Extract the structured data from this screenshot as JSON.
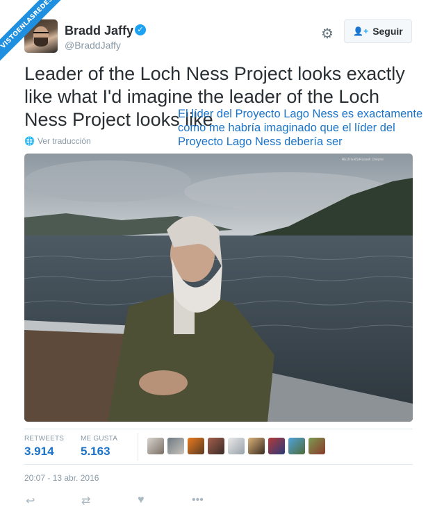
{
  "watermark": "VISTOENLASREDES",
  "author": {
    "name": "Bradd Jaffy",
    "handle": "@BraddJaffy",
    "verified": true
  },
  "header": {
    "settings_icon": "gear-icon",
    "follow_label": "Seguir"
  },
  "tweet": {
    "text": "Leader of the Loch Ness Project looks exactly like what I'd imagine the leader of the Loch Ness Project looks like",
    "translation_overlay": "El líder del Proyecto Lago Ness es exactamente como me habría imaginado que el líder del Proyecto Lago Ness debería ser",
    "view_translation": "Ver traducción"
  },
  "photo": {
    "credit": "REUTERS/Russell Cheyne"
  },
  "stats": {
    "retweets_label": "RETWEETS",
    "retweets_value": "3.914",
    "likes_label": "ME GUSTA",
    "likes_value": "5.163"
  },
  "timestamp": "20:07 - 13 abr. 2016",
  "actions": [
    "reply-icon",
    "retweet-icon",
    "like-icon",
    "more-icon"
  ],
  "colors": {
    "accent": "#1da1f2",
    "link": "#1a73c8",
    "muted": "#8899a6"
  }
}
